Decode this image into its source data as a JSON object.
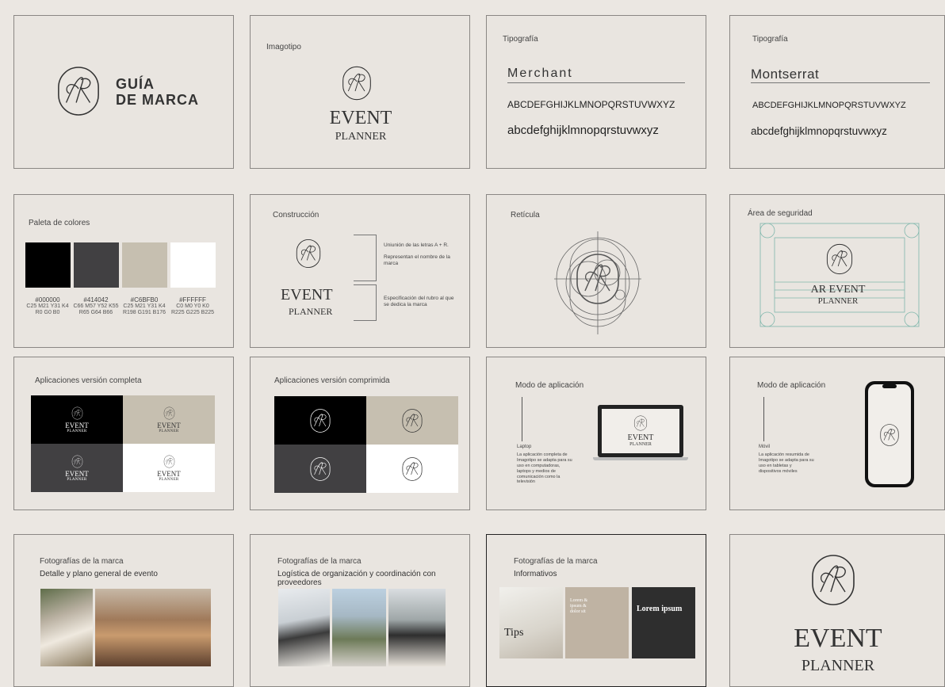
{
  "slides": {
    "cover": {
      "title_line1": "GUÍA",
      "title_line2": "DE MARCA"
    },
    "imagotipo": {
      "title": "Imagotipo",
      "event": "EVENT",
      "planner": "PLANNER"
    },
    "typo1": {
      "title": "Tipografía",
      "font_name": "Merchant",
      "upper": "ABCDEFGHIJKLMNOPQRSTUVWXYZ",
      "lower": "abcdefghijklmnopqrstuvwxyz"
    },
    "typo2": {
      "title": "Tipografía",
      "font_name": "Montserrat",
      "upper": "ABCDEFGHIJKLMNOPQRSTUVWXYZ",
      "lower": "abcdefghijklmnopqrstuvwxyz"
    },
    "palette": {
      "title": "Paleta de colores",
      "colors": [
        {
          "hex": "#000000",
          "color": "#000000",
          "l1": "C25 M21 Y31 K4",
          "l2": "R0 G0 B0"
        },
        {
          "hex": "#414042",
          "color": "#414042",
          "l1": "C66 M57 Y52 K55",
          "l2": "R65 G64 B66"
        },
        {
          "hex": "#C6BFB0",
          "color": "#C6BFB0",
          "l1": "C25 M21 Y31 K4",
          "l2": "R198 G191 B176"
        },
        {
          "hex": "#FFFFFF",
          "color": "#FFFFFF",
          "l1": "C0 M0 Y0 K0",
          "l2": "R225 G225 B225"
        }
      ]
    },
    "construction": {
      "title": "Construcción",
      "event": "EVENT",
      "planner": "PLANNER",
      "note1a": "Uniunión de las letras A + R.",
      "note1b": "Representan el nombre de la marca",
      "note2": "Especificación del rubro al que se dedica la marca"
    },
    "grid": {
      "title": "Retícula"
    },
    "safety": {
      "title": "Área de seguridad",
      "line1": "AR EVENT",
      "line2": "PLANNER"
    },
    "app_full": {
      "title": "Aplicaciones versión completa",
      "event": "EVENT",
      "planner": "PLANNER"
    },
    "app_comp": {
      "title": "Aplicaciones versión comprimida"
    },
    "mode_laptop": {
      "title": "Modo de aplicación",
      "label": "Laptop",
      "text": "La aplicación completa de Imagotipo se adapta para su uso en computadoras, laptops y medios de comunicación como la televisión",
      "event": "EVENT",
      "planner": "PLANNER"
    },
    "mode_mobile": {
      "title": "Modo de aplicación",
      "label": "Móvil",
      "text": "La aplicación resumida de Imagotipo se adapta para su uso en tabletas y dispositivos móviles"
    },
    "photos1": {
      "title": "Fotografías de la marca",
      "subtitle": "Detalle y plano general de evento"
    },
    "photos2": {
      "title": "Fotografías de la marca",
      "subtitle": "Logística de organización y coordinación con proveedores"
    },
    "photos3": {
      "title": "Fotografías de la marca",
      "subtitle": "Informativos",
      "tips": "Tips",
      "lorem_small": "Lorem & ipsum & dolor sit",
      "lorem_big": "Lorem ipsum"
    },
    "final": {
      "event": "EVENT",
      "planner": "PLANNER"
    }
  },
  "colors": {
    "bg": "#e9e5e0",
    "ink": "#3a3a3a",
    "beige": "#C6BFB0",
    "dark": "#414042"
  },
  "icons": [
    "ar-monogram-icon",
    "laptop-icon",
    "phone-icon"
  ]
}
